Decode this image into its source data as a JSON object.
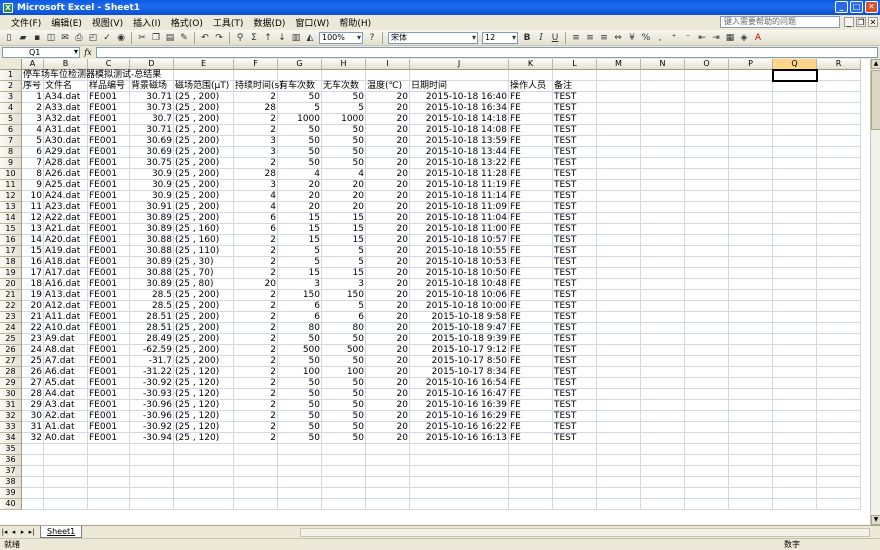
{
  "window": {
    "title": "Microsoft Excel - Sheet1"
  },
  "menu": [
    "文件(F)",
    "编辑(E)",
    "视图(V)",
    "插入(I)",
    "格式(O)",
    "工具(T)",
    "数据(D)",
    "窗口(W)",
    "帮助(H)"
  ],
  "help_placeholder": "键入需要帮助的问题",
  "toolbar": {
    "zoom": "100%",
    "font": "宋体",
    "size": "12",
    "bold": "B",
    "italic": "I",
    "underline": "U"
  },
  "name_box": "Q1",
  "fx": "fx",
  "columns": [
    "A",
    "B",
    "C",
    "D",
    "E",
    "F",
    "G",
    "H",
    "I",
    "J",
    "K",
    "L",
    "M",
    "N",
    "O",
    "P",
    "Q",
    "R"
  ],
  "title_row": "停车场车位检测器模拟测试-总结果",
  "headers": [
    "序号",
    "文件名",
    "样品编号",
    "背景磁场",
    "磁场范围(μT)",
    "持续时间(s)",
    "有车次数",
    "无车次数",
    "温度(℃)",
    "日期时间",
    "操作人员",
    "备注"
  ],
  "rows": [
    [
      "1",
      "A34.dat",
      "FE001",
      "30.71",
      "(25 , 200)",
      "2",
      "50",
      "50",
      "20",
      "2015-10-18 16:40",
      "FE",
      "TEST"
    ],
    [
      "2",
      "A33.dat",
      "FE001",
      "30.73",
      "(25 , 200)",
      "28",
      "5",
      "5",
      "20",
      "2015-10-18 16:34",
      "FE",
      "TEST"
    ],
    [
      "3",
      "A32.dat",
      "FE001",
      "30.7",
      "(25 , 200)",
      "2",
      "1000",
      "1000",
      "20",
      "2015-10-18 14:18",
      "FE",
      "TEST"
    ],
    [
      "4",
      "A31.dat",
      "FE001",
      "30.71",
      "(25 , 200)",
      "2",
      "50",
      "50",
      "20",
      "2015-10-18 14:08",
      "FE",
      "TEST"
    ],
    [
      "5",
      "A30.dat",
      "FE001",
      "30.69",
      "(25 , 200)",
      "3",
      "50",
      "50",
      "20",
      "2015-10-18 13:59",
      "FE",
      "TEST"
    ],
    [
      "6",
      "A29.dat",
      "FE001",
      "30.69",
      "(25 , 200)",
      "3",
      "50",
      "50",
      "20",
      "2015-10-18 13:44",
      "FE",
      "TEST"
    ],
    [
      "7",
      "A28.dat",
      "FE001",
      "30.75",
      "(25 , 200)",
      "2",
      "50",
      "50",
      "20",
      "2015-10-18 13:22",
      "FE",
      "TEST"
    ],
    [
      "8",
      "A26.dat",
      "FE001",
      "30.9",
      "(25 , 200)",
      "28",
      "4",
      "4",
      "20",
      "2015-10-18 11:28",
      "FE",
      "TEST"
    ],
    [
      "9",
      "A25.dat",
      "FE001",
      "30.9",
      "(25 , 200)",
      "3",
      "20",
      "20",
      "20",
      "2015-10-18 11:19",
      "FE",
      "TEST"
    ],
    [
      "10",
      "A24.dat",
      "FE001",
      "30.9",
      "(25 , 200)",
      "4",
      "20",
      "20",
      "20",
      "2015-10-18 11:14",
      "FE",
      "TEST"
    ],
    [
      "11",
      "A23.dat",
      "FE001",
      "30.91",
      "(25 , 200)",
      "4",
      "20",
      "20",
      "20",
      "2015-10-18 11:09",
      "FE",
      "TEST"
    ],
    [
      "12",
      "A22.dat",
      "FE001",
      "30.89",
      "(25 , 200)",
      "6",
      "15",
      "15",
      "20",
      "2015-10-18 11:04",
      "FE",
      "TEST"
    ],
    [
      "13",
      "A21.dat",
      "FE001",
      "30.89",
      "(25 , 160)",
      "6",
      "15",
      "15",
      "20",
      "2015-10-18 11:00",
      "FE",
      "TEST"
    ],
    [
      "14",
      "A20.dat",
      "FE001",
      "30.88",
      "(25 , 160)",
      "2",
      "15",
      "15",
      "20",
      "2015-10-18 10:57",
      "FE",
      "TEST"
    ],
    [
      "15",
      "A19.dat",
      "FE001",
      "30.88",
      "(25 , 110)",
      "2",
      "5",
      "5",
      "20",
      "2015-10-18 10:55",
      "FE",
      "TEST"
    ],
    [
      "16",
      "A18.dat",
      "FE001",
      "30.89",
      "(25 , 30)",
      "2",
      "5",
      "5",
      "20",
      "2015-10-18 10:53",
      "FE",
      "TEST"
    ],
    [
      "17",
      "A17.dat",
      "FE001",
      "30.88",
      "(25 , 70)",
      "2",
      "15",
      "15",
      "20",
      "2015-10-18 10:50",
      "FE",
      "TEST"
    ],
    [
      "18",
      "A16.dat",
      "FE001",
      "30.89",
      "(25 , 80)",
      "20",
      "3",
      "3",
      "20",
      "2015-10-18 10:48",
      "FE",
      "TEST"
    ],
    [
      "19",
      "A13.dat",
      "FE001",
      "28.5",
      "(25 , 200)",
      "2",
      "150",
      "150",
      "20",
      "2015-10-18 10:06",
      "FE",
      "TEST"
    ],
    [
      "20",
      "A12.dat",
      "FE001",
      "28.5",
      "(25 , 200)",
      "2",
      "6",
      "5",
      "20",
      "2015-10-18 10:00",
      "FE",
      "TEST"
    ],
    [
      "21",
      "A11.dat",
      "FE001",
      "28.51",
      "(25 , 200)",
      "2",
      "6",
      "6",
      "20",
      "2015-10-18 9:58",
      "FE",
      "TEST"
    ],
    [
      "22",
      "A10.dat",
      "FE001",
      "28.51",
      "(25 , 200)",
      "2",
      "80",
      "80",
      "20",
      "2015-10-18 9:47",
      "FE",
      "TEST"
    ],
    [
      "23",
      "A9.dat",
      "FE001",
      "28.49",
      "(25 , 200)",
      "2",
      "50",
      "50",
      "20",
      "2015-10-18 9:39",
      "FE",
      "TEST"
    ],
    [
      "24",
      "A8.dat",
      "FE001",
      "-62.59",
      "(25 , 200)",
      "2",
      "500",
      "500",
      "20",
      "2015-10-17 9:12",
      "FE",
      "TEST"
    ],
    [
      "25",
      "A7.dat",
      "FE001",
      "-31.7",
      "(25 , 200)",
      "2",
      "50",
      "50",
      "20",
      "2015-10-17 8:50",
      "FE",
      "TEST"
    ],
    [
      "26",
      "A6.dat",
      "FE001",
      "-31.22",
      "(25 , 120)",
      "2",
      "100",
      "100",
      "20",
      "2015-10-17 8:34",
      "FE",
      "TEST"
    ],
    [
      "27",
      "A5.dat",
      "FE001",
      "-30.92",
      "(25 , 120)",
      "2",
      "50",
      "50",
      "20",
      "2015-10-16 16:54",
      "FE",
      "TEST"
    ],
    [
      "28",
      "A4.dat",
      "FE001",
      "-30.93",
      "(25 , 120)",
      "2",
      "50",
      "50",
      "20",
      "2015-10-16 16:47",
      "FE",
      "TEST"
    ],
    [
      "29",
      "A3.dat",
      "FE001",
      "-30.96",
      "(25 , 120)",
      "2",
      "50",
      "50",
      "20",
      "2015-10-16 16:39",
      "FE",
      "TEST"
    ],
    [
      "30",
      "A2.dat",
      "FE001",
      "-30.96",
      "(25 , 120)",
      "2",
      "50",
      "50",
      "20",
      "2015-10-16 16:29",
      "FE",
      "TEST"
    ],
    [
      "31",
      "A1.dat",
      "FE001",
      "-30.92",
      "(25 , 120)",
      "2",
      "50",
      "50",
      "20",
      "2015-10-16 16:22",
      "FE",
      "TEST"
    ],
    [
      "32",
      "A0.dat",
      "FE001",
      "-30.94",
      "(25 , 120)",
      "2",
      "50",
      "50",
      "20",
      "2015-10-16 16:13",
      "FE",
      "TEST"
    ]
  ],
  "row_count": 40,
  "sheet_tab": "Sheet1",
  "status": {
    "ready": "就绪",
    "numlock": "数字"
  }
}
